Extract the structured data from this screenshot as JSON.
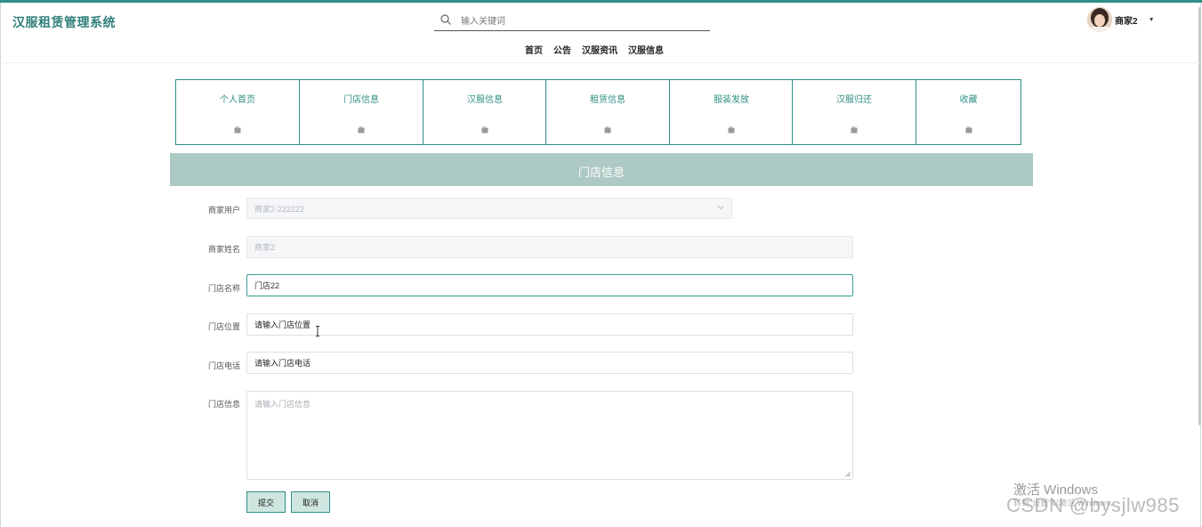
{
  "app": {
    "title": "汉服租赁管理系统"
  },
  "search": {
    "placeholder": "输入关键词"
  },
  "nav": [
    {
      "label": "首页"
    },
    {
      "label": "公告"
    },
    {
      "label": "汉服资讯"
    },
    {
      "label": "汉服信息"
    }
  ],
  "user": {
    "name": "商家2"
  },
  "tiles": [
    {
      "label": "个人首页"
    },
    {
      "label": "门店信息"
    },
    {
      "label": "汉服信息"
    },
    {
      "label": "租赁信息"
    },
    {
      "label": "服装发放"
    },
    {
      "label": "汉服归还"
    },
    {
      "label": "收藏"
    }
  ],
  "section": {
    "title": "门店信息"
  },
  "form": {
    "merchant_user": {
      "label": "商家用户",
      "value": "商家2-222222"
    },
    "merchant_name": {
      "label": "商家姓名",
      "value": "商家2"
    },
    "store_name": {
      "label": "门店名称",
      "value": "门店22"
    },
    "store_location": {
      "label": "门店位置",
      "value": "请输入门店位置"
    },
    "store_phone": {
      "label": "门店电话",
      "value": "请输入门店电话"
    },
    "store_info": {
      "label": "门店信息",
      "placeholder": "请输入门店信息"
    }
  },
  "buttons": {
    "submit": "提交",
    "cancel": "取消"
  },
  "watermark": {
    "line1": "激活 Windows",
    "line2": "转到\"设置\"以激活 Windows。",
    "csdn": "CSDN @bysjlw985"
  },
  "colors": {
    "accent": "#2f8f86",
    "section_bar": "#adc9c3",
    "button_bg": "#cfe6e0"
  }
}
